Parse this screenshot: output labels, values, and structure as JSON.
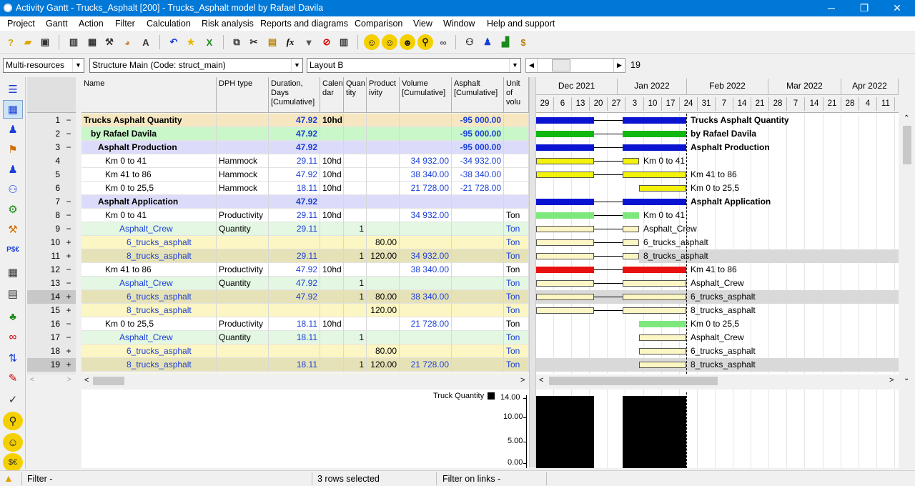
{
  "window": {
    "title": "Activity Gantt - Trucks_Asphalt [200] - Trucks_Asphalt model by Rafael Davila"
  },
  "menu": [
    "Project",
    "Gantt",
    "Action",
    "Filter",
    "Calculation",
    "Risk analysis",
    "Reports and diagrams",
    "Comparison",
    "View",
    "Window",
    "Help and support"
  ],
  "toolbar": {
    "zoom_value": "19"
  },
  "selectors": {
    "resources": "Multi-resources",
    "structure": "Structure Main (Code: struct_main)",
    "layout": "Layout B"
  },
  "columns": {
    "name": "Name",
    "dph": "DPH type",
    "duration": [
      "Duration,",
      "Days",
      "[Cumulative]"
    ],
    "calendar": [
      "Calen",
      "dar"
    ],
    "quantity": [
      "Quan",
      "tity"
    ],
    "productivity": [
      "Product",
      "ivity"
    ],
    "volume": [
      "Volume",
      "[Cumulative]"
    ],
    "asphalt": [
      "Asphalt",
      "[Cumulative]"
    ],
    "unit": [
      "Unit",
      "of",
      "volu"
    ]
  },
  "rows": [
    {
      "num": "1",
      "pm": "−",
      "name": "Trucks Asphalt Quantity",
      "dph": "",
      "dur": "47.92",
      "cal": "10hd",
      "qty": "",
      "prod": "",
      "vol": "",
      "asph": "-95 000.00",
      "unit": ""
    },
    {
      "num": "2",
      "pm": "−",
      "name": "by Rafael Davila",
      "dph": "",
      "dur": "47.92",
      "cal": "",
      "qty": "",
      "prod": "",
      "vol": "",
      "asph": "-95 000.00",
      "unit": ""
    },
    {
      "num": "3",
      "pm": "−",
      "name": "Asphalt Production",
      "dph": "",
      "dur": "47.92",
      "cal": "",
      "qty": "",
      "prod": "",
      "vol": "",
      "asph": "-95 000.00",
      "unit": ""
    },
    {
      "num": "4",
      "pm": "",
      "name": "Km 0 to 41",
      "dph": "Hammock",
      "dur": "29.11",
      "cal": "10hd",
      "qty": "",
      "prod": "",
      "vol": "34 932.00",
      "asph": "-34 932.00",
      "unit": ""
    },
    {
      "num": "5",
      "pm": "",
      "name": "Km 41 to 86",
      "dph": "Hammock",
      "dur": "47.92",
      "cal": "10hd",
      "qty": "",
      "prod": "",
      "vol": "38 340.00",
      "asph": "-38 340.00",
      "unit": ""
    },
    {
      "num": "6",
      "pm": "",
      "name": "Km 0 to 25,5",
      "dph": "Hammock",
      "dur": "18.11",
      "cal": "10hd",
      "qty": "",
      "prod": "",
      "vol": "21 728.00",
      "asph": "-21 728.00",
      "unit": ""
    },
    {
      "num": "7",
      "pm": "−",
      "name": "Asphalt Application",
      "dph": "",
      "dur": "47.92",
      "cal": "",
      "qty": "",
      "prod": "",
      "vol": "",
      "asph": "",
      "unit": ""
    },
    {
      "num": "8",
      "pm": "−",
      "name": "Km 0 to 41",
      "dph": "Productivity",
      "dur": "29.11",
      "cal": "10hd",
      "qty": "",
      "prod": "",
      "vol": "34 932.00",
      "asph": "",
      "unit": "Ton"
    },
    {
      "num": "9",
      "pm": "−",
      "name": "Asphalt_Crew",
      "dph": "Quantity",
      "dur": "29.11",
      "cal": "",
      "qty": "1",
      "prod": "",
      "vol": "",
      "asph": "",
      "unit": "Ton"
    },
    {
      "num": "10",
      "pm": "+",
      "name": "6_trucks_asphalt",
      "dph": "",
      "dur": "",
      "cal": "",
      "qty": "",
      "prod": "80.00",
      "vol": "",
      "asph": "",
      "unit": "Ton"
    },
    {
      "num": "11",
      "pm": "+",
      "name": "8_trucks_asphalt",
      "dph": "",
      "dur": "29.11",
      "cal": "",
      "qty": "1",
      "prod": "120.00",
      "vol": "34 932.00",
      "asph": "",
      "unit": "Ton"
    },
    {
      "num": "12",
      "pm": "−",
      "name": "Km 41 to 86",
      "dph": "Productivity",
      "dur": "47.92",
      "cal": "10hd",
      "qty": "",
      "prod": "",
      "vol": "38 340.00",
      "asph": "",
      "unit": "Ton"
    },
    {
      "num": "13",
      "pm": "−",
      "name": "Asphalt_Crew",
      "dph": "Quantity",
      "dur": "47.92",
      "cal": "",
      "qty": "1",
      "prod": "",
      "vol": "",
      "asph": "",
      "unit": "Ton"
    },
    {
      "num": "14",
      "pm": "+",
      "name": "6_trucks_asphalt",
      "dph": "",
      "dur": "47.92",
      "cal": "",
      "qty": "1",
      "prod": "80.00",
      "vol": "38 340.00",
      "asph": "",
      "unit": "Ton"
    },
    {
      "num": "15",
      "pm": "+",
      "name": "8_trucks_asphalt",
      "dph": "",
      "dur": "",
      "cal": "",
      "qty": "",
      "prod": "120.00",
      "vol": "",
      "asph": "",
      "unit": "Ton"
    },
    {
      "num": "16",
      "pm": "−",
      "name": "Km 0 to 25,5",
      "dph": "Productivity",
      "dur": "18.11",
      "cal": "10hd",
      "qty": "",
      "prod": "",
      "vol": "21 728.00",
      "asph": "",
      "unit": "Ton"
    },
    {
      "num": "17",
      "pm": "−",
      "name": "Asphalt_Crew",
      "dph": "Quantity",
      "dur": "18.11",
      "cal": "",
      "qty": "1",
      "prod": "",
      "vol": "",
      "asph": "",
      "unit": "Ton"
    },
    {
      "num": "18",
      "pm": "+",
      "name": "6_trucks_asphalt",
      "dph": "",
      "dur": "",
      "cal": "",
      "qty": "",
      "prod": "80.00",
      "vol": "",
      "asph": "",
      "unit": "Ton"
    },
    {
      "num": "19",
      "pm": "+",
      "name": "8_trucks_asphalt",
      "dph": "",
      "dur": "18.11",
      "cal": "",
      "qty": "1",
      "prod": "120.00",
      "vol": "21 728.00",
      "asph": "",
      "unit": "Ton"
    }
  ],
  "gantt": {
    "months": [
      "Dec 2021",
      "Jan 2022",
      "Feb 2022",
      "Mar 2022",
      "Apr 2022"
    ],
    "days": [
      "29",
      "6",
      "13",
      "20",
      "27",
      "3",
      "10",
      "17",
      "24",
      "31",
      "7",
      "14",
      "21",
      "28",
      "7",
      "14",
      "21",
      "28",
      "4",
      "11",
      "1"
    ],
    "labels": [
      "Trucks Asphalt Quantity",
      "by Rafael Davila",
      "Asphalt Production",
      "Km 0 to 41",
      "Km 41 to 86",
      "Km 0 to 25,5",
      "Asphalt Application",
      "Km 0 to 41",
      "Asphalt_Crew",
      "6_trucks_asphalt",
      "8_trucks_asphalt",
      "Km 41 to 86",
      "Asphalt_Crew",
      "6_trucks_asphalt",
      "8_trucks_asphalt",
      "Km 0 to 25,5",
      "Asphalt_Crew",
      "6_trucks_asphalt",
      "8_trucks_asphalt"
    ]
  },
  "histogram": {
    "legend": "Truck Quantity",
    "ticks": [
      "14.00",
      "10.00",
      "5.00",
      "0.00"
    ]
  },
  "status": {
    "filter": "Filter -",
    "selected": "3 rows selected",
    "links": "Filter on links -"
  }
}
